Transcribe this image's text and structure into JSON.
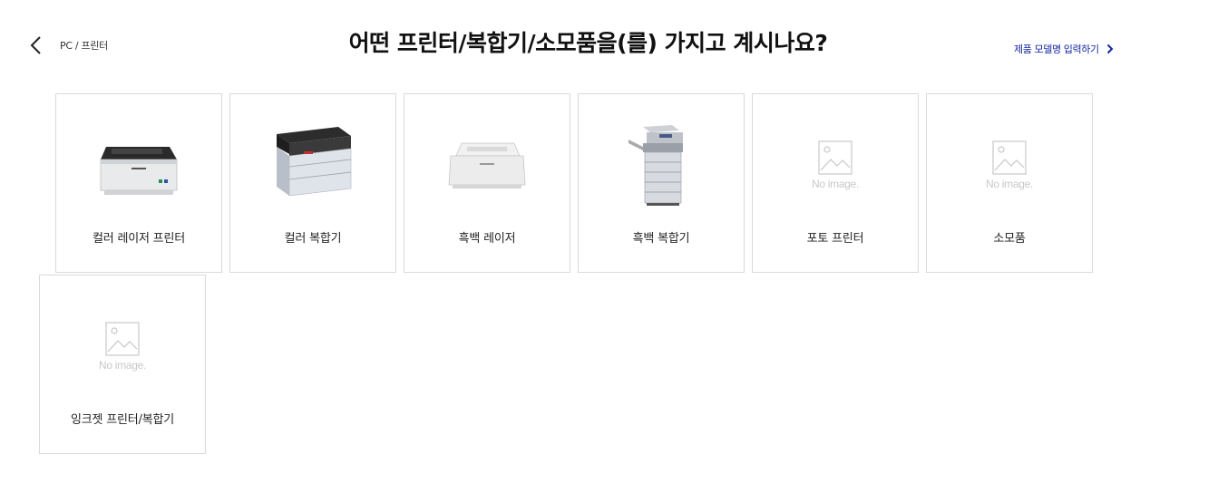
{
  "header": {
    "breadcrumb": "PC / 프린터",
    "title": "어떤 프린터/복합기/소모품을(를) 가지고 계시나요?",
    "model_link": "제품 모델명 입력하기"
  },
  "categories": [
    {
      "label": "컬러 레이저 프린터",
      "image": "color-laser-printer"
    },
    {
      "label": "컬러 복합기",
      "image": "color-multifunction-printer"
    },
    {
      "label": "흑백 레이저",
      "image": "mono-laser-printer"
    },
    {
      "label": "흑백 복합기",
      "image": "mono-multifunction-copier"
    },
    {
      "label": "포토 프린터",
      "image": "no-image",
      "placeholder": "No image."
    },
    {
      "label": "소모품",
      "image": "no-image",
      "placeholder": "No image."
    },
    {
      "label": "잉크젯 프린터/복합기",
      "image": "no-image",
      "placeholder": "No image."
    }
  ],
  "colors": {
    "link": "#1428a0",
    "border": "#d9d9d9",
    "placeholder": "#c8c8c8"
  },
  "icons": {
    "back": "chevron-left-icon",
    "forward": "chevron-right-icon"
  }
}
